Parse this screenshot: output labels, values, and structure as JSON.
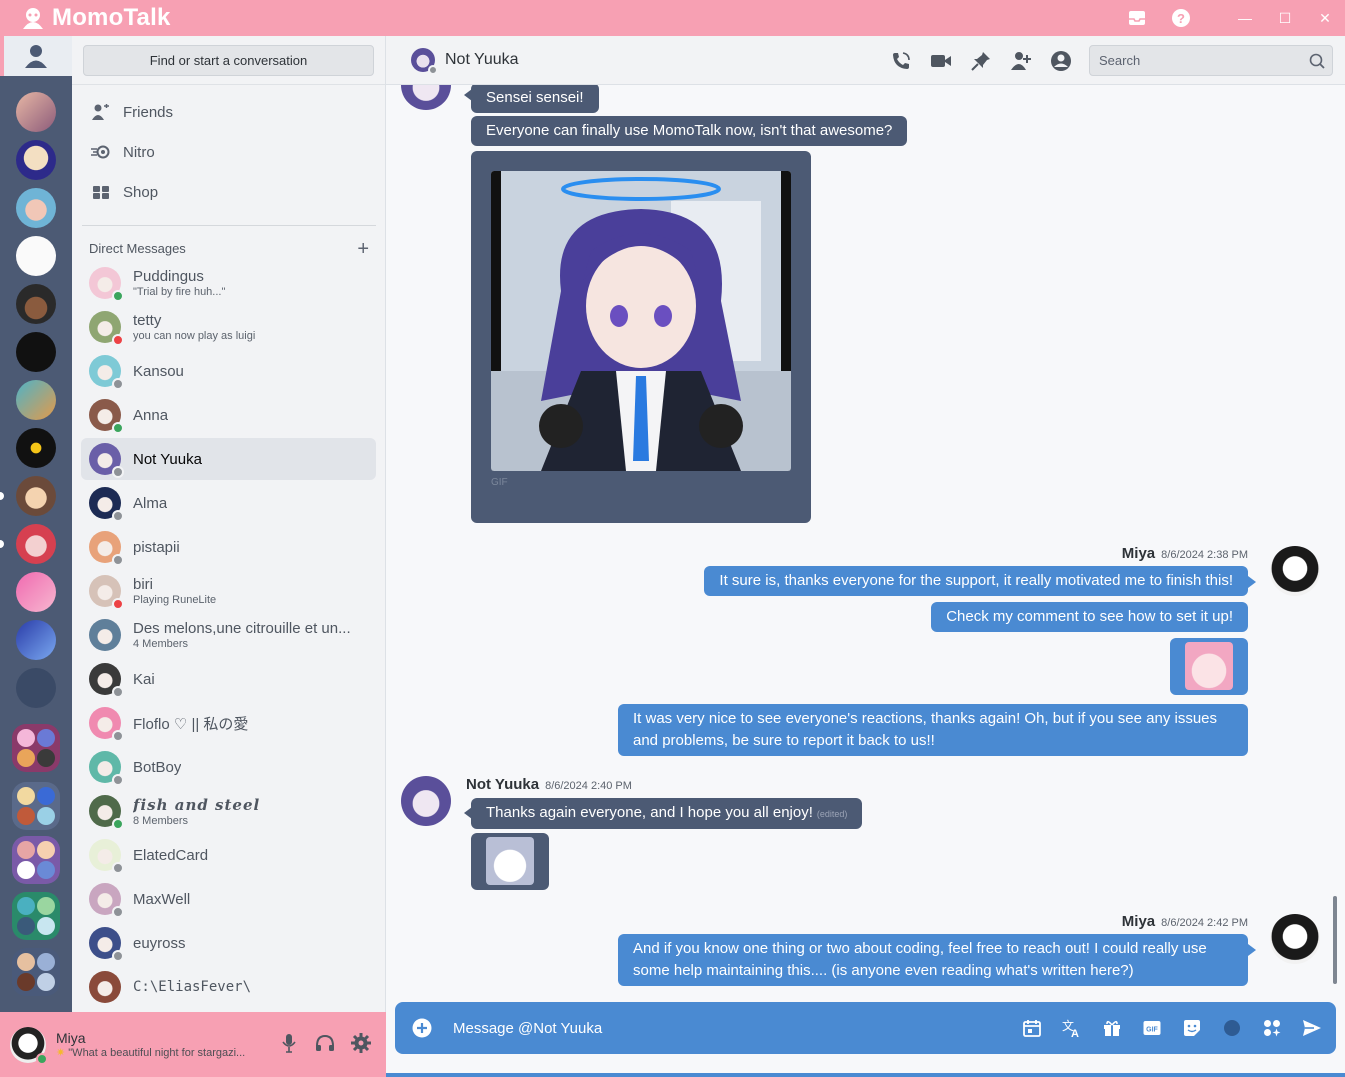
{
  "app": {
    "name": "MomoTalk"
  },
  "colors": {
    "accent_pink": "#f7a0b3",
    "incoming_bubble": "#4c5a74",
    "outgoing_bubble": "#4a8ad2",
    "online": "#3ba55d",
    "dnd": "#ed4245",
    "offline": "#8e9297"
  },
  "sidebar": {
    "find_placeholder": "Find or start a conversation",
    "nav": [
      {
        "label": "Friends",
        "icon": "friends-icon"
      },
      {
        "label": "Nitro",
        "icon": "nitro-icon"
      },
      {
        "label": "Shop",
        "icon": "shop-icon"
      }
    ],
    "dm_header": "Direct Messages",
    "dms": [
      {
        "name": "Puddingus",
        "sub": "\"Trial by fire huh...\"",
        "status": "online",
        "color": "#f3c7d6"
      },
      {
        "name": "tetty",
        "sub": "you can now play as luigi",
        "status": "dnd",
        "color": "#8fa672"
      },
      {
        "name": "Kansou",
        "sub": "",
        "status": "offline",
        "color": "#7ecad6"
      },
      {
        "name": "Anna",
        "sub": "",
        "status": "online",
        "color": "#8a5a4a"
      },
      {
        "name": "Not Yuuka",
        "sub": "",
        "status": "offline",
        "color": "#6a5fa8",
        "active": true
      },
      {
        "name": "Alma",
        "sub": "",
        "status": "offline",
        "color": "#1d2b54"
      },
      {
        "name": "pistapii",
        "sub": "",
        "status": "offline",
        "color": "#e8a27a"
      },
      {
        "name": "biri",
        "sub": "Playing RuneLite",
        "status": "dnd",
        "color": "#d6c2b8"
      },
      {
        "name": "Des melons,une citrouille et un...",
        "sub": "4 Members",
        "status": "",
        "color": "#5f7f9a"
      },
      {
        "name": "Kai",
        "sub": "",
        "status": "offline",
        "color": "#3a3a3a"
      },
      {
        "name": "Floflo ♡ || 私の愛",
        "sub": "",
        "status": "offline",
        "color": "#f08ab0"
      },
      {
        "name": "BotBoy",
        "sub": "",
        "status": "offline",
        "color": "#5fb8a8"
      },
      {
        "name": "fish and steel",
        "sub": "8 Members",
        "status": "online",
        "color": "#4f6a4a"
      },
      {
        "name": "ElatedCard",
        "sub": "",
        "status": "offline",
        "color": "#e8f0d8"
      },
      {
        "name": "MaxWell",
        "sub": "",
        "status": "offline",
        "color": "#c9a6c0"
      },
      {
        "name": "euyross",
        "sub": "",
        "status": "offline",
        "color": "#3d4f8a"
      },
      {
        "name": "C:\\EliasFever\\",
        "sub": "",
        "status": "",
        "color": "#8a4a3a"
      }
    ]
  },
  "user": {
    "name": "Miya",
    "status_text": "\"What a beautiful night for stargazi..."
  },
  "header": {
    "name": "Not Yuuka",
    "search_placeholder": "Search"
  },
  "messages": {
    "m1": "Sensei sensei!",
    "m2": "Everyone can finally use MomoTalk now, isn't that awesome?",
    "gif_label": "GIF",
    "g2_author": "Miya",
    "g2_time": "8/6/2024 2:38 PM",
    "m3": "It sure is, thanks everyone for the support, it really motivated me to finish this!",
    "m4": "Check my comment to see how to set it up!",
    "m5": "It was very nice to see everyone's reactions, thanks again! Oh, but if you see any issues and problems, be sure to report it back to us!!",
    "g3_author": "Not Yuuka",
    "g3_time": "8/6/2024 2:40 PM",
    "m6": "Thanks again everyone, and I hope you all enjoy!",
    "m6_edited": "(edited)",
    "g4_author": "Miya",
    "g4_time": "8/6/2024 2:42 PM",
    "m7": "And if you know one thing or two about coding, feel free to reach out! I could really use some help maintaining this.... (is anyone even reading what's written here?)"
  },
  "composer": {
    "placeholder": "Message @Not Yuuka"
  }
}
